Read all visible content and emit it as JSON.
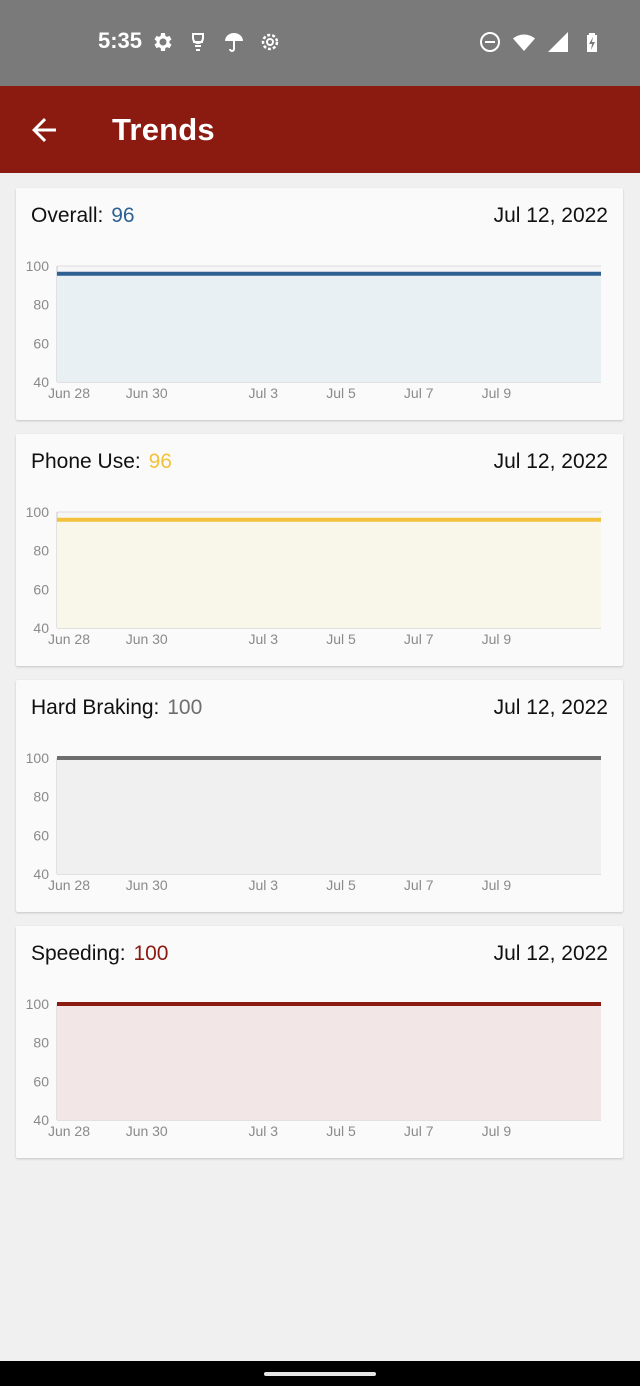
{
  "status_bar": {
    "time": "5:35",
    "left_icons": [
      "settings-icon",
      "lens-icon",
      "umbrella-icon",
      "settings-outline-icon"
    ],
    "right_icons": [
      "dnd-icon",
      "wifi-icon",
      "signal-icon",
      "battery-charging-icon"
    ]
  },
  "app_bar": {
    "title": "Trends",
    "back_icon": "arrow-back-icon",
    "color": "#8b1a11"
  },
  "cards": [
    {
      "label": "Overall:",
      "score": "96",
      "date": "Jul 12, 2022",
      "color": "#2e6091",
      "fill": "#e9f0f3",
      "chart_data": {
        "type": "area",
        "x": [
          "Jun 28",
          "Jun 29",
          "Jun 30",
          "Jul 1",
          "Jul 2",
          "Jul 3",
          "Jul 4",
          "Jul 5",
          "Jul 6",
          "Jul 7",
          "Jul 8",
          "Jul 9",
          "Jul 10",
          "Jul 11",
          "Jul 12"
        ],
        "tick_labels": [
          "Jun 28",
          "Jun 30",
          "Jul 3",
          "Jul 5",
          "Jul 7",
          "Jul 9"
        ],
        "values": [
          96,
          96,
          96,
          96,
          96,
          96,
          96,
          96,
          96,
          96,
          96,
          96,
          96,
          96,
          96
        ],
        "ylim": [
          40,
          100
        ],
        "yticks": [
          100,
          80,
          60,
          40
        ],
        "grid": true
      }
    },
    {
      "label": "Phone Use:",
      "score": "96",
      "date": "Jul 12, 2022",
      "color": "#f3c13a",
      "fill": "#f9f6ea",
      "chart_data": {
        "type": "area",
        "x": [
          "Jun 28",
          "Jun 29",
          "Jun 30",
          "Jul 1",
          "Jul 2",
          "Jul 3",
          "Jul 4",
          "Jul 5",
          "Jul 6",
          "Jul 7",
          "Jul 8",
          "Jul 9",
          "Jul 10",
          "Jul 11",
          "Jul 12"
        ],
        "tick_labels": [
          "Jun 28",
          "Jun 30",
          "Jul 3",
          "Jul 5",
          "Jul 7",
          "Jul 9"
        ],
        "values": [
          96,
          96,
          96,
          96,
          96,
          96,
          96,
          96,
          96,
          96,
          96,
          96,
          96,
          96,
          96
        ],
        "ylim": [
          40,
          100
        ],
        "yticks": [
          100,
          80,
          60,
          40
        ],
        "grid": true
      }
    },
    {
      "label": "Hard Braking:",
      "score": "100",
      "date": "Jul 12, 2022",
      "color": "#6e6e6e",
      "fill": "#f0f0f0",
      "chart_data": {
        "type": "area",
        "x": [
          "Jun 28",
          "Jun 29",
          "Jun 30",
          "Jul 1",
          "Jul 2",
          "Jul 3",
          "Jul 4",
          "Jul 5",
          "Jul 6",
          "Jul 7",
          "Jul 8",
          "Jul 9",
          "Jul 10",
          "Jul 11",
          "Jul 12"
        ],
        "tick_labels": [
          "Jun 28",
          "Jun 30",
          "Jul 3",
          "Jul 5",
          "Jul 7",
          "Jul 9"
        ],
        "values": [
          100,
          100,
          100,
          100,
          100,
          100,
          100,
          100,
          100,
          100,
          100,
          100,
          100,
          100,
          100
        ],
        "ylim": [
          40,
          100
        ],
        "yticks": [
          100,
          80,
          60,
          40
        ],
        "grid": true
      }
    },
    {
      "label": "Speeding:",
      "score": "100",
      "date": "Jul 12, 2022",
      "color": "#8b1a11",
      "fill": "#f3e6e6",
      "chart_data": {
        "type": "area",
        "x": [
          "Jun 28",
          "Jun 29",
          "Jun 30",
          "Jul 1",
          "Jul 2",
          "Jul 3",
          "Jul 4",
          "Jul 5",
          "Jul 6",
          "Jul 7",
          "Jul 8",
          "Jul 9",
          "Jul 10",
          "Jul 11",
          "Jul 12"
        ],
        "tick_labels": [
          "Jun 28",
          "Jun 30",
          "Jul 3",
          "Jul 5",
          "Jul 7",
          "Jul 9"
        ],
        "values": [
          100,
          100,
          100,
          100,
          100,
          100,
          100,
          100,
          100,
          100,
          100,
          100,
          100,
          100,
          100
        ],
        "ylim": [
          40,
          100
        ],
        "yticks": [
          100,
          80,
          60,
          40
        ],
        "grid": true
      }
    }
  ]
}
